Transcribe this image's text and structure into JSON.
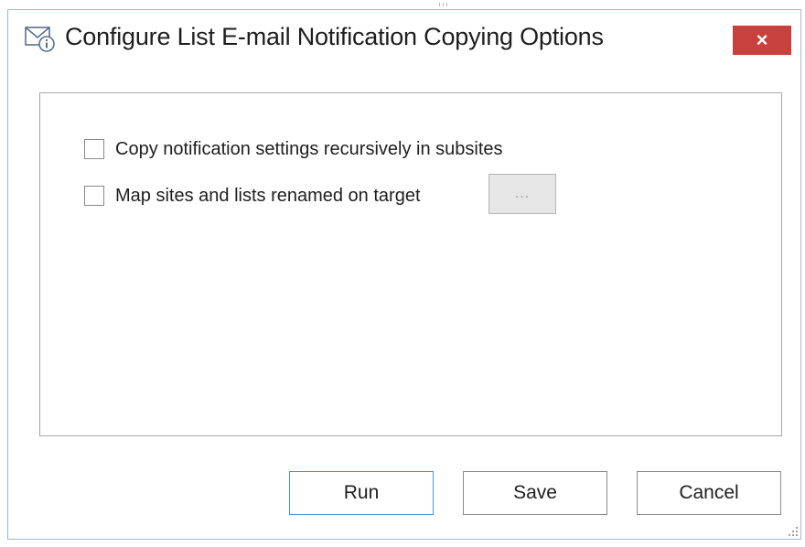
{
  "window": {
    "title": "Configure List E-mail Notification Copying Options",
    "close_label": "×"
  },
  "options": [
    {
      "label": "Copy notification settings recursively in subsites",
      "checked": false
    },
    {
      "label": "Map sites and lists renamed on target",
      "checked": false
    }
  ],
  "browse_button": {
    "label": "..."
  },
  "buttons": {
    "run": "Run",
    "save": "Save",
    "cancel": "Cancel"
  },
  "colors": {
    "close_button": "#c9413f",
    "primary_border": "#4a90d9",
    "window_border": "#9fb8d4"
  },
  "icons": {
    "title": "mail-info-icon",
    "close": "close-icon",
    "resize": "resize-grip-icon"
  }
}
